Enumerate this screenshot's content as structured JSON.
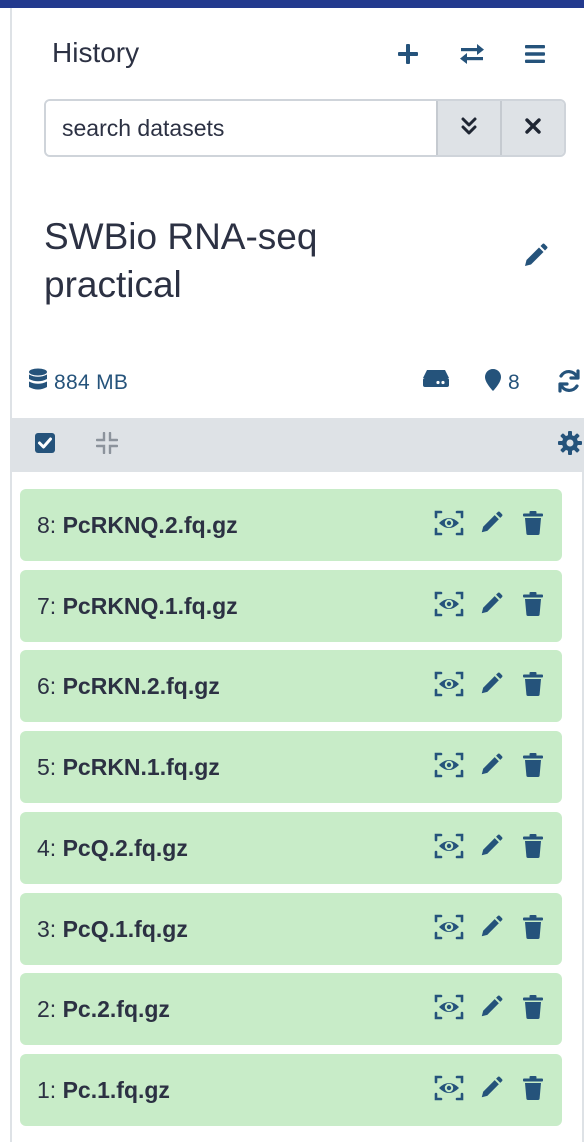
{
  "header": {
    "title": "History",
    "new_icon": "plus-icon",
    "switch_icon": "exchange-icon",
    "options_icon": "bars-icon"
  },
  "search": {
    "placeholder": "search datasets",
    "advanced_icon": "angle-double-down-icon",
    "clear_icon": "times-icon"
  },
  "history": {
    "name": "SWBio RNA-seq practical",
    "edit_icon": "pen-icon"
  },
  "stats": {
    "size": "884 MB",
    "size_icon": "database-icon",
    "storage_icon": "hdd-icon",
    "shown_count": "8",
    "shown_icon": "map-marker-icon",
    "refresh_icon": "sync-icon"
  },
  "toolbar": {
    "select_icon": "check-square-icon",
    "collapse_icon": "compress-icon",
    "settings_icon": "cog-icon"
  },
  "items": [
    {
      "hid": "8:",
      "name": "PcRKNQ.2.fq.gz"
    },
    {
      "hid": "7:",
      "name": "PcRKNQ.1.fq.gz"
    },
    {
      "hid": "6:",
      "name": "PcRKN.2.fq.gz"
    },
    {
      "hid": "5:",
      "name": "PcRKN.1.fq.gz"
    },
    {
      "hid": "4:",
      "name": "PcQ.2.fq.gz"
    },
    {
      "hid": "3:",
      "name": "PcQ.1.fq.gz"
    },
    {
      "hid": "2:",
      "name": "Pc.2.fq.gz"
    },
    {
      "hid": "1:",
      "name": "Pc.1.fq.gz"
    }
  ],
  "item_actions": [
    "eye-icon",
    "pencil-icon",
    "trash-icon"
  ],
  "colors": {
    "accent": "#25537b",
    "top_bar": "#233a8e",
    "item_ok": "#c8ecc8",
    "toolbar_bg": "#dee2e6"
  }
}
